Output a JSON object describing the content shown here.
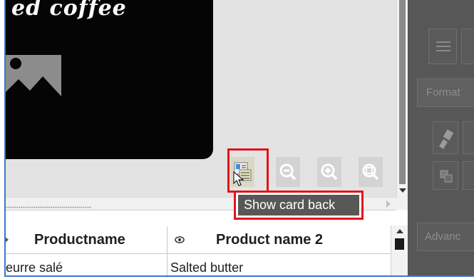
{
  "canvas": {
    "card_text": "ed coffee"
  },
  "toolbar": {
    "buttons": [
      {
        "icon": "card-back-icon",
        "active": true
      },
      {
        "icon": "zoom-out-icon"
      },
      {
        "icon": "zoom-in-icon"
      },
      {
        "icon": "zoom-fit-icon"
      }
    ],
    "tooltip": "Show card back"
  },
  "grid": {
    "columns": [
      {
        "label": "Productname"
      },
      {
        "label": "Product name 2"
      }
    ],
    "rows": [
      [
        "eurre salé",
        "Salted butter"
      ]
    ]
  },
  "right_panel": {
    "format_label": "Format",
    "advanced_label": "Advanc"
  },
  "colors": {
    "highlight": "#e2141c",
    "tooltip_bg": "#575757",
    "panel_bg": "#575757",
    "accent_border": "#3c78c8"
  }
}
